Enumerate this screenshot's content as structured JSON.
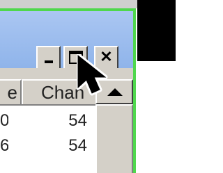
{
  "titlebar": {
    "minimize_symbol": "_",
    "maximize_symbol": "□",
    "close_symbol": "✕"
  },
  "table": {
    "columns": [
      "e",
      "Chan"
    ],
    "rows": [
      [
        "0",
        "54"
      ],
      [
        "6",
        "54"
      ]
    ]
  },
  "colors": {
    "window_border": "#4fd74d",
    "titlebar": "#8fb4ea",
    "button_face": "#d4d0c8"
  }
}
